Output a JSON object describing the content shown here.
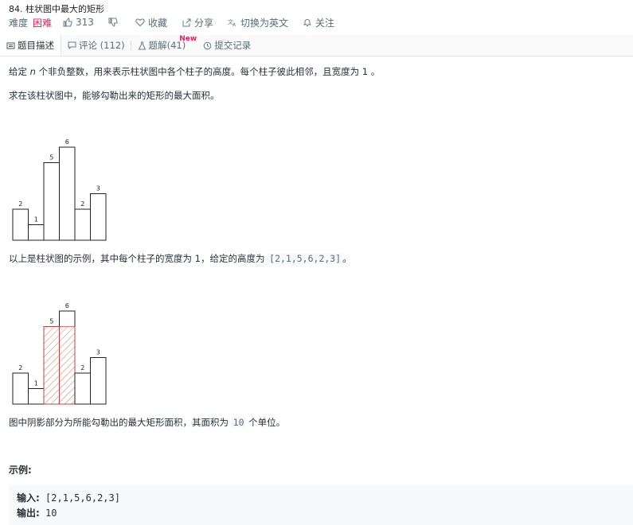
{
  "problem": {
    "title": "84. 柱状图中最大的矩形",
    "difficulty_label": "难度",
    "difficulty": "困难",
    "likes": "313",
    "favorite": "收藏",
    "share": "分享",
    "switch_lang": "切换为英文",
    "follow": "关注"
  },
  "tabs": [
    {
      "label": "题目描述"
    },
    {
      "label": "评论 (112)"
    },
    {
      "label": "题解(41)",
      "badge": "New"
    },
    {
      "label": "提交记录"
    }
  ],
  "description": {
    "p1_prefix": "给定",
    "p1_n": "n",
    "p1_suffix": "个非负整数，用来表示柱状图中各个柱子的高度。每个柱子彼此相邻，且宽度为 1 。",
    "p2": "求在该柱状图中，能够勾勒出来的矩形的最大面积。",
    "p3_prefix": "以上是柱状图的示例，其中每个柱子的宽度为 1，给定的高度为",
    "p3_code": "[2,1,5,6,2,3]",
    "p3_suffix": "。",
    "p4_prefix": "图中阴影部分为所能勾勒出的最大矩形面积，其面积为",
    "p4_code": "10",
    "p4_suffix": "个单位。"
  },
  "figures": {
    "heights": [
      2,
      1,
      5,
      6,
      2,
      3
    ],
    "labels": [
      "2",
      "1",
      "5",
      "6",
      "2",
      "3"
    ],
    "shaded_bars": [
      2,
      3
    ],
    "shade_color": "#d9534f"
  },
  "example": {
    "title": "示例:",
    "input_label": "输入:",
    "input_value": "[2,1,5,6,2,3]",
    "output_label": "输出:",
    "output_value": "10"
  }
}
